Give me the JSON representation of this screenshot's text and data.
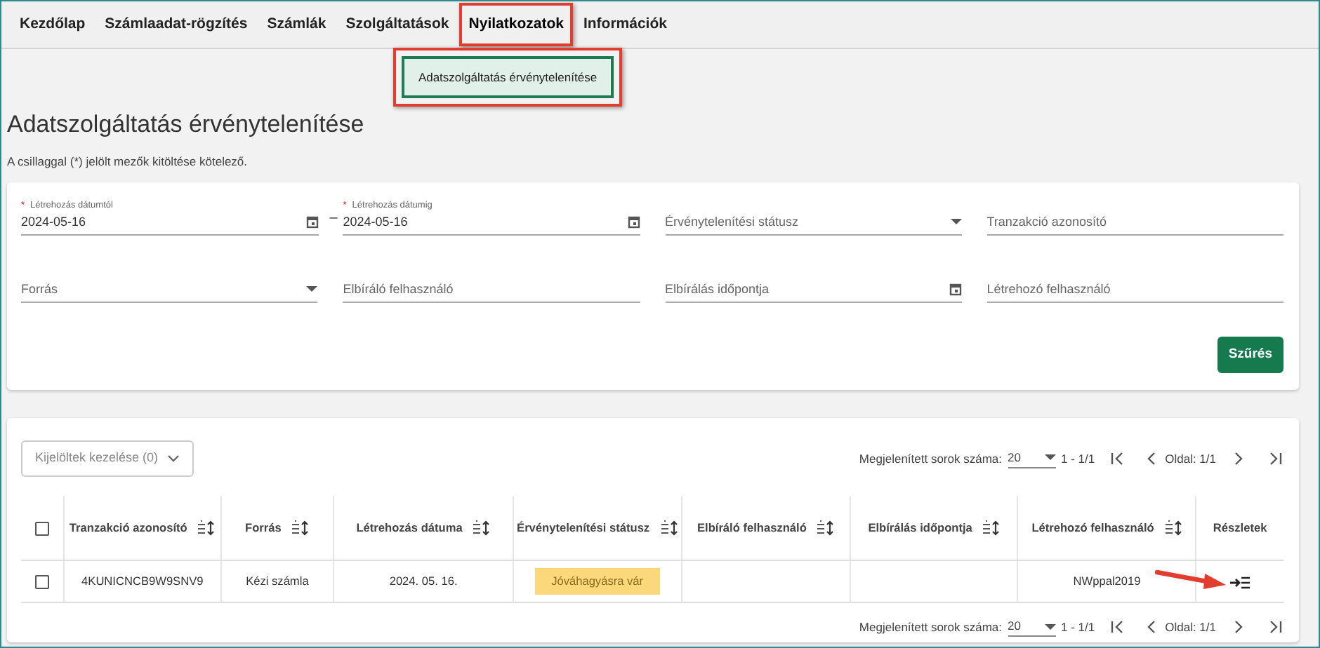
{
  "nav": [
    {
      "label": "Kezdőlap",
      "selected": false,
      "highlighted": false
    },
    {
      "label": "Számlaadat-rögzítés",
      "selected": false,
      "highlighted": false
    },
    {
      "label": "Számlák",
      "selected": false,
      "highlighted": false
    },
    {
      "label": "Szolgáltatások",
      "selected": false,
      "highlighted": false
    },
    {
      "label": "Nyilatkozatok",
      "selected": true,
      "highlighted": true
    },
    {
      "label": "Információk",
      "selected": false,
      "highlighted": false
    }
  ],
  "dropdown": {
    "highlighted": true,
    "items": [
      {
        "label": "Adatszolgáltatás érvénytelenítése",
        "selected": true
      }
    ]
  },
  "page": {
    "title": "Adatszolgáltatás érvénytelenítése",
    "note": "A csillaggal (*) jelölt mezők kitöltése kötelező."
  },
  "filters": {
    "range_separator": "–",
    "required_mark": "*",
    "rows": [
      [
        {
          "kind": "date",
          "label": "Létrehozás dátumtól",
          "required": true,
          "value": "2024-05-16"
        },
        {
          "kind": "date",
          "label": "Létrehozás dátumig",
          "required": true,
          "value": "2024-05-16"
        },
        {
          "kind": "select",
          "placeholder": "Érvénytelenítési státusz"
        },
        {
          "kind": "text",
          "placeholder": "Tranzakció azonosító"
        }
      ],
      [
        {
          "kind": "select",
          "placeholder": "Forrás"
        },
        {
          "kind": "text",
          "placeholder": "Elbíráló felhasználó"
        },
        {
          "kind": "date",
          "placeholder": "Elbírálás időpontja"
        },
        {
          "kind": "text",
          "placeholder": "Létrehozó felhasználó"
        }
      ]
    ],
    "submit": "Szűrés"
  },
  "bulk_button": {
    "label": "Kijelöltek kezelése (0)",
    "disabled": true
  },
  "pagination": [
    {
      "label": "Megjelenített sorok száma:",
      "page_size": "20",
      "range": "1 - 1/1",
      "page": "Oldal: 1/1"
    },
    {
      "label": "Megjelenített sorok száma:",
      "page_size": "20",
      "range": "1 - 1/1",
      "page": "Oldal: 1/1"
    }
  ],
  "table": {
    "select_all_checked": false,
    "columns": [
      {
        "label": "Tranzakció azonosító",
        "sortable": true
      },
      {
        "label": "Forrás",
        "sortable": true
      },
      {
        "label": "Létrehozás dátuma",
        "sortable": true
      },
      {
        "label": "Érvénytelenítési státusz",
        "sortable": true
      },
      {
        "label": "Elbíráló felhasználó",
        "sortable": true
      },
      {
        "label": "Elbírálás időpontja",
        "sortable": true
      },
      {
        "label": "Létrehozó felhasználó",
        "sortable": true
      },
      {
        "label": "Részletek",
        "sortable": false
      }
    ],
    "rows": [
      {
        "checked": false,
        "cells": [
          "4KUNICNCB9W9SNV9",
          "Kézi számla",
          "2024. 05. 16.",
          {
            "kind": "status",
            "text": "Jóváhagyásra vár",
            "color": "#fbd97a"
          },
          "",
          "",
          "NWppal2019",
          {
            "kind": "details",
            "annotated": true
          }
        ]
      }
    ]
  }
}
